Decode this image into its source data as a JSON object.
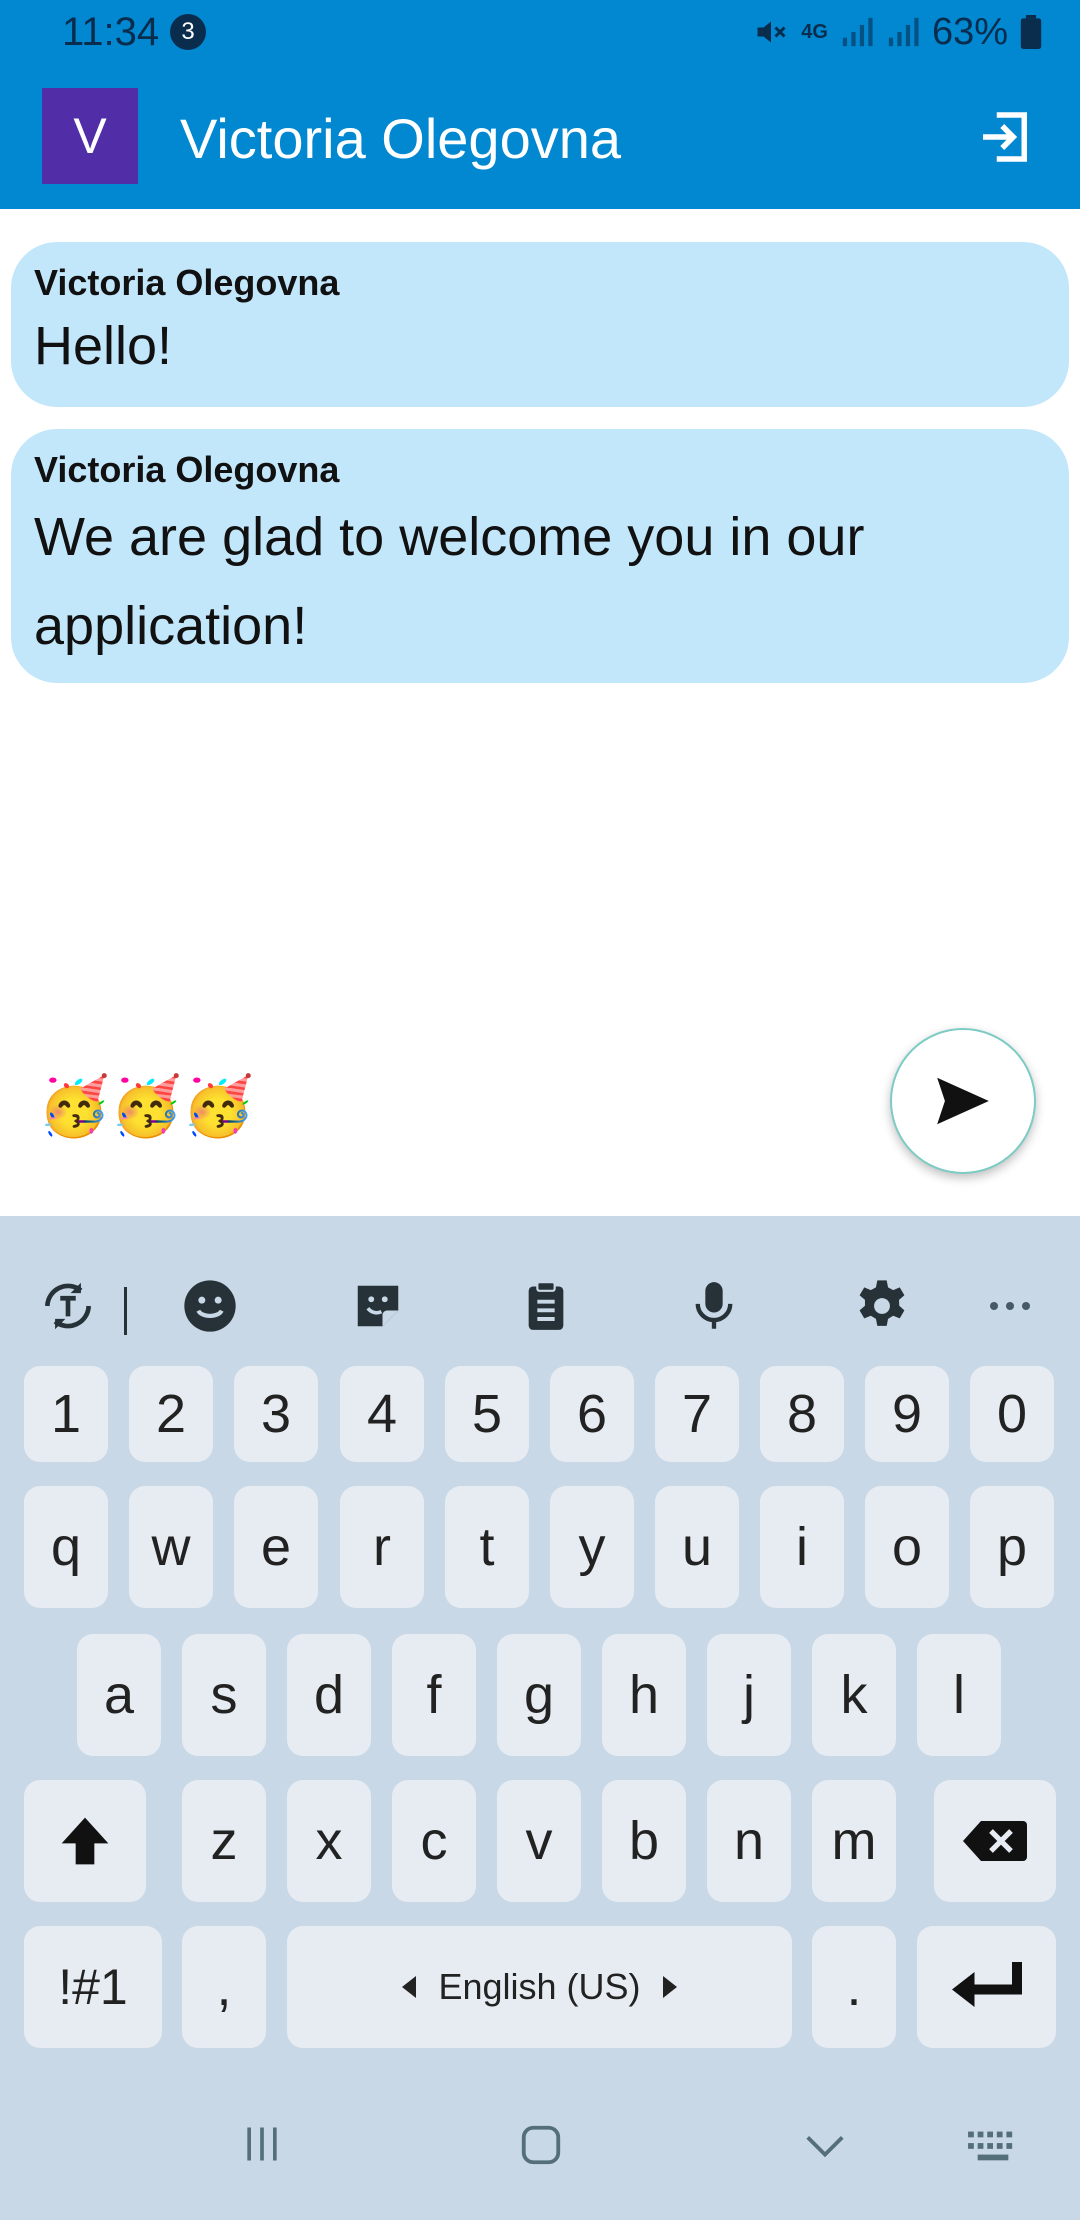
{
  "status_bar": {
    "time": "11:34",
    "notification_count": "3",
    "network": "4G",
    "battery": "63%"
  },
  "app_bar": {
    "avatar_letter": "V",
    "title": "Victoria Olegovna",
    "avatar_color": "#512da8",
    "bar_color": "#0288d1"
  },
  "messages": [
    {
      "author": "Victoria Olegovna",
      "text": "Hello!"
    },
    {
      "author": "Victoria Olegovna",
      "text": "We are glad to welcome you in our application!"
    }
  ],
  "composer": {
    "value": "🥳🥳🥳"
  },
  "keyboard": {
    "toolbar": [
      "text-style-icon",
      "emoji-icon",
      "sticker-icon",
      "clipboard-icon",
      "microphone-icon",
      "settings-icon",
      "more-icon"
    ],
    "numbers": [
      "1",
      "2",
      "3",
      "4",
      "5",
      "6",
      "7",
      "8",
      "9",
      "0"
    ],
    "row1": [
      "q",
      "w",
      "e",
      "r",
      "t",
      "y",
      "u",
      "i",
      "o",
      "p"
    ],
    "row2": [
      "a",
      "s",
      "d",
      "f",
      "g",
      "h",
      "j",
      "k",
      "l"
    ],
    "row3": [
      "z",
      "x",
      "c",
      "v",
      "b",
      "n",
      "m"
    ],
    "symbols_label": "!#1",
    "comma": ",",
    "space_label": "English (US)",
    "period": "."
  },
  "nav_bar": [
    "recents-icon",
    "home-icon",
    "back-icon",
    "keyboard-icon"
  ]
}
